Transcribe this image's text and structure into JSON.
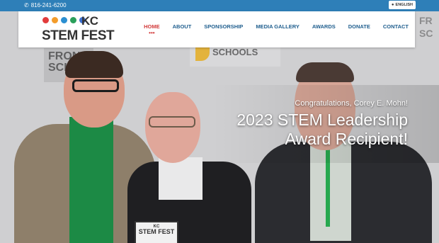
{
  "topbar": {
    "phone": "816-241-6200",
    "language": "ENGLISH"
  },
  "logo": {
    "kc": "KC",
    "title": "STEM FEST",
    "dot_colors": [
      "#e23b3b",
      "#f39c2b",
      "#2b8fd1",
      "#2a9f5a",
      "#3b6fd1"
    ]
  },
  "nav": {
    "items": [
      "HOME",
      "ABOUT",
      "SPONSORSHIP",
      "MEDIA GALLERY",
      "AWARDS",
      "DONATE",
      "CONTACT"
    ],
    "active_index": 0,
    "active_marker": "•••"
  },
  "hero": {
    "banner_line1": "FRONTIER",
    "banner_line2": "SCHOOLS",
    "congrats": "Congratulations, Corey E. Mohn!",
    "headline": "2023 STEM Leadership Award Recipient!",
    "plaque_title": "STEM FEST",
    "plaque_kc": "KC"
  }
}
